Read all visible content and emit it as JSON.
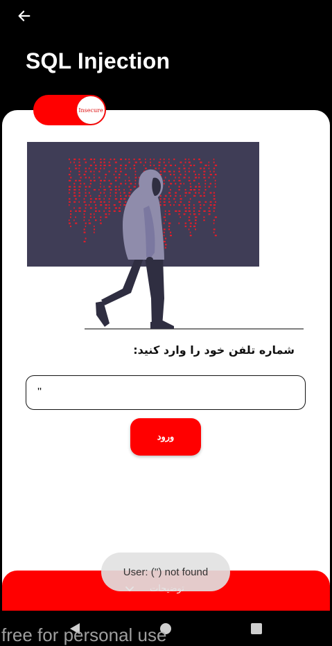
{
  "header": {
    "title": "SQL Injection",
    "back_icon": "arrow-left-icon"
  },
  "mode_toggle": {
    "label": "Insecure",
    "state": "on"
  },
  "form": {
    "prompt": "شماره تلفن خود را وارد کنید:",
    "phone_value": "''",
    "submit_label": "ورود"
  },
  "bottom_panel": {
    "label": "توضیحات",
    "chevron_icon": "chevron-down-icon"
  },
  "toast": {
    "message": "User: ('') not found"
  },
  "system_nav": {
    "back_icon": "nav-back-icon",
    "home_icon": "nav-home-icon",
    "recents_icon": "nav-recents-icon"
  },
  "watermark": {
    "text": "free for personal use"
  },
  "colors": {
    "accent": "#ff0000",
    "background": "#000000",
    "card": "#ffffff",
    "screen": "#3f3d56",
    "hoodie": "#8f8cab"
  }
}
